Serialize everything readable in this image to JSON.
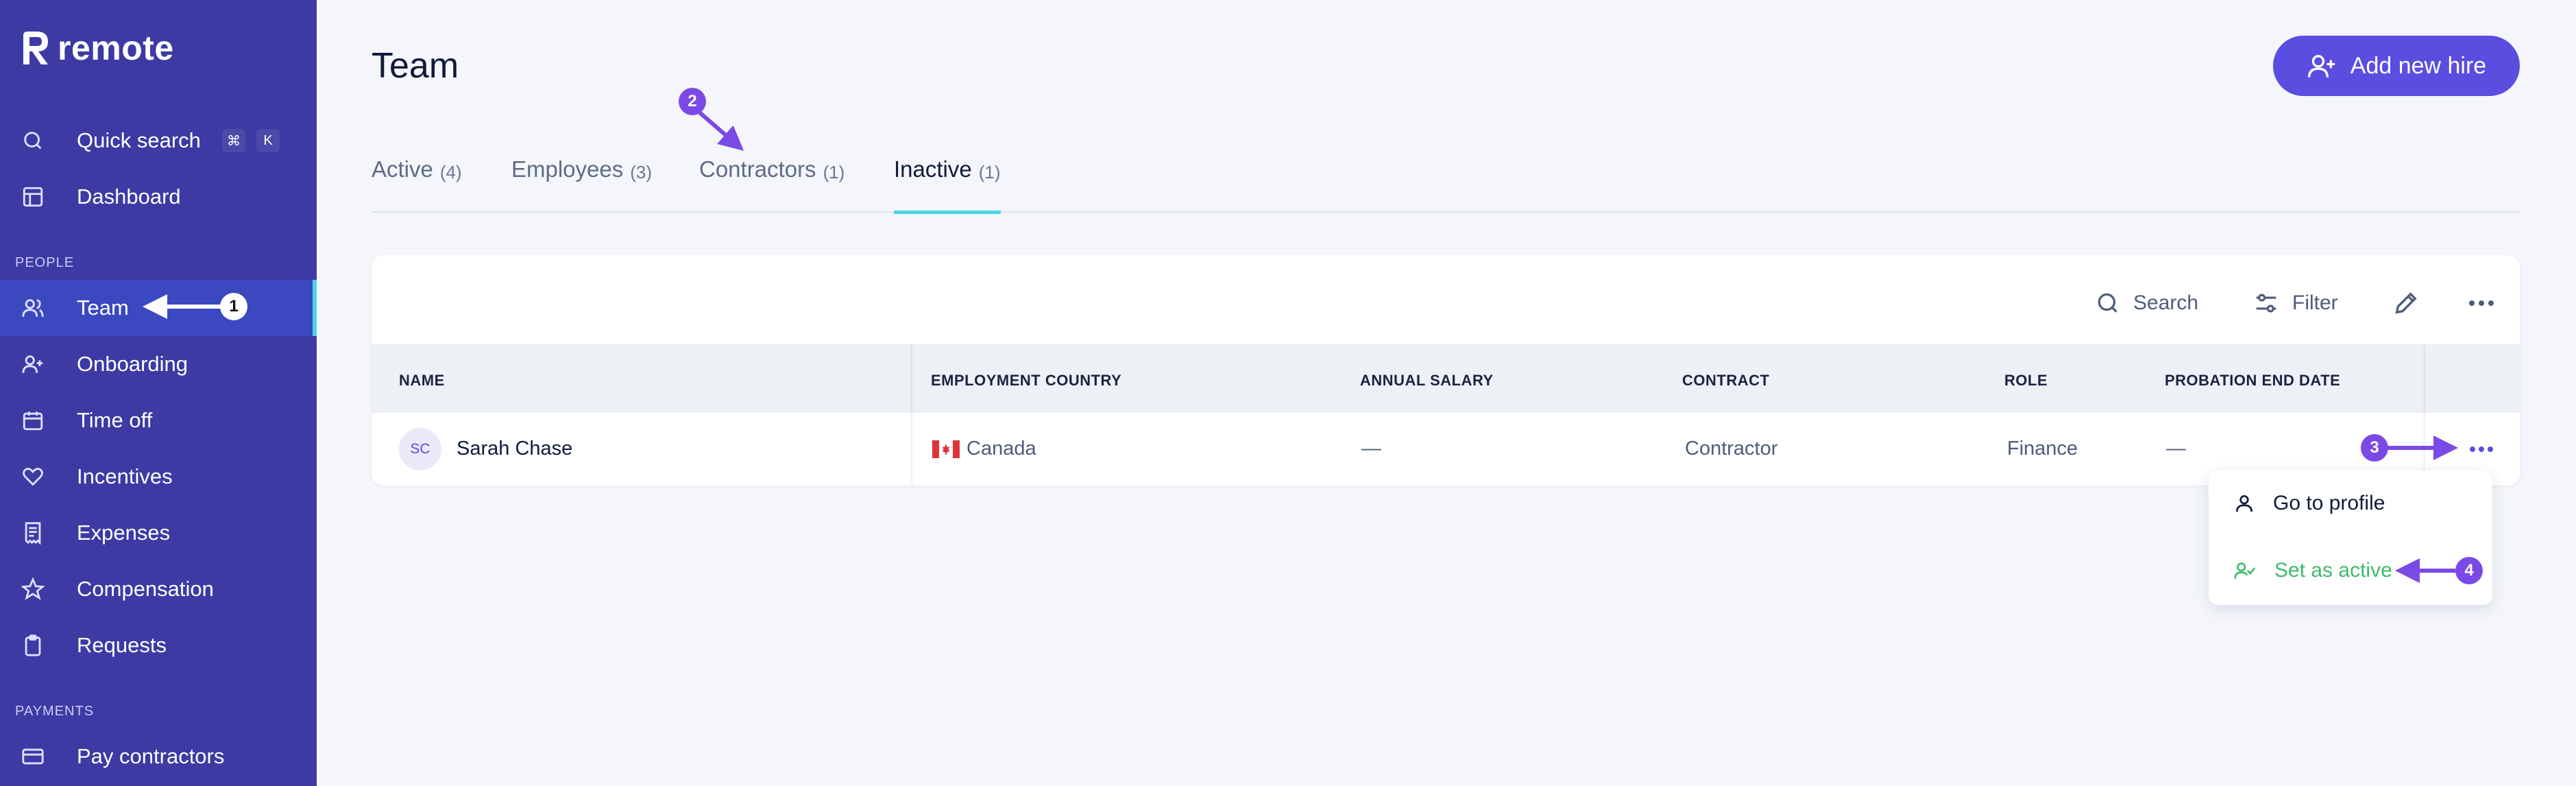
{
  "brand": {
    "name": "remote"
  },
  "sidebar": {
    "quick_search": {
      "label": "Quick search",
      "kbd1": "⌘",
      "kbd2": "K"
    },
    "dashboard": "Dashboard",
    "people_section": "PEOPLE",
    "items": [
      {
        "label": "Team",
        "icon": "users-icon"
      },
      {
        "label": "Onboarding",
        "icon": "user-plus-icon"
      },
      {
        "label": "Time off",
        "icon": "calendar-icon"
      },
      {
        "label": "Incentives",
        "icon": "heart-icon"
      },
      {
        "label": "Expenses",
        "icon": "receipt-icon"
      },
      {
        "label": "Compensation",
        "icon": "star-icon"
      },
      {
        "label": "Requests",
        "icon": "clipboard-icon"
      }
    ],
    "payments_section": "PAYMENTS",
    "payments_items": [
      {
        "label": "Pay contractors",
        "icon": "credit-card-icon"
      }
    ]
  },
  "header": {
    "title": "Team",
    "add_button": "Add new hire"
  },
  "tabs": [
    {
      "label": "Active",
      "count": "(4)"
    },
    {
      "label": "Employees",
      "count": "(3)"
    },
    {
      "label": "Contractors",
      "count": "(1)"
    },
    {
      "label": "Inactive",
      "count": "(1)"
    }
  ],
  "toolbar": {
    "search": "Search",
    "filter": "Filter"
  },
  "table": {
    "columns": [
      "NAME",
      "EMPLOYMENT COUNTRY",
      "ANNUAL SALARY",
      "CONTRACT",
      "ROLE",
      "PROBATION END DATE"
    ],
    "rows": [
      {
        "initials": "SC",
        "name": "Sarah Chase",
        "country": "Canada",
        "salary": "—",
        "contract": "Contractor",
        "role": "Finance",
        "probation": "—"
      }
    ]
  },
  "row_menu": {
    "go_to_profile": "Go to profile",
    "set_active": "Set as active"
  },
  "annotations": [
    "1",
    "2",
    "3",
    "4"
  ],
  "colors": {
    "sidebar_bg": "#3d3aa4",
    "accent": "#5b4de0",
    "tab_underline": "#49d6e6",
    "annotation": "#7b4ae6",
    "success": "#3dbb6b"
  }
}
